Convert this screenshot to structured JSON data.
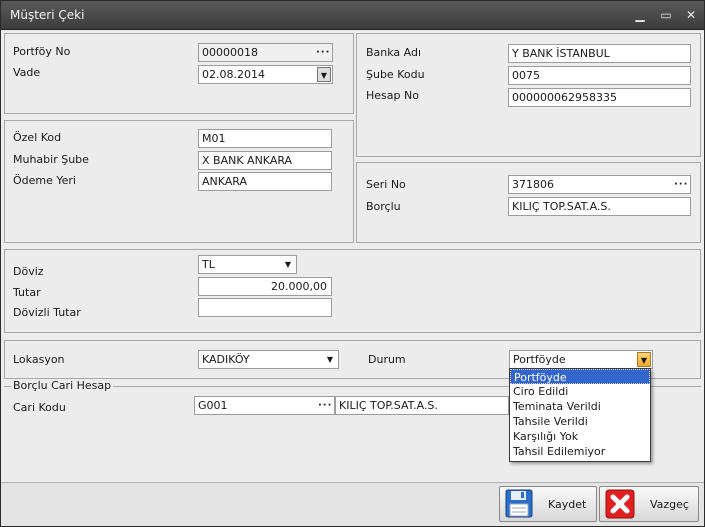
{
  "window": {
    "title": "Müşteri Çeki",
    "minimize": "▁",
    "maximize": "▭",
    "close": "✕"
  },
  "portfoy": {
    "portfoy_no_label": "Portföy No",
    "portfoy_no": "00000018",
    "vade_label": "Vade",
    "vade": "02.08.2014",
    "ellipsis": "···",
    "dropdown_arrow": "▼"
  },
  "banka": {
    "banka_adi_label": "Banka Adı",
    "banka_adi": "Y BANK İSTANBUL",
    "sube_kodu_label": "Şube Kodu",
    "sube_kodu": "0075",
    "hesap_no_label": "Hesap No",
    "hesap_no": "000000062958335"
  },
  "ozel": {
    "ozel_kod_label": "Özel Kod",
    "ozel_kod": "M01",
    "muhabir_sube_label": "Muhabir Şube",
    "muhabir_sube": "X BANK ANKARA",
    "odeme_yeri_label": "Ödeme Yeri",
    "odeme_yeri": "ANKARA"
  },
  "seri": {
    "seri_no_label": "Seri No",
    "seri_no": "371806",
    "borclu_label": "Borçlu",
    "borclu": "KILIÇ TOP.SAT.A.S."
  },
  "doviz": {
    "doviz_label": "Döviz",
    "doviz": "TL",
    "tutar_label": "Tutar",
    "tutar": "20.000,00",
    "dovizli_tutar_label": "Dövizli Tutar",
    "dovizli_tutar": ""
  },
  "lokasyon": {
    "lokasyon_label": "Lokasyon",
    "lokasyon": "KADIKÖY",
    "durum_label": "Durum",
    "durum": "Portföyde"
  },
  "durum_options": [
    "Portföyde",
    "Ciro Edildi",
    "Teminata Verildi",
    "Tahsile Verildi",
    "Karşılığı Yok",
    "Tahsil Edilemiyor"
  ],
  "cari": {
    "group_label": "Borçlu Cari Hesap",
    "cari_kodu_label": "Cari Kodu",
    "cari_kodu": "G001",
    "cari_adi": "KILIÇ TOP.SAT.A.S."
  },
  "buttons": {
    "save": "Kaydet",
    "cancel": "Vazgeç"
  },
  "colors": {
    "titlebar": "#3c3c3c",
    "selection": "#3366cc",
    "cancel_icon": "#e02020",
    "save_icon": "#2a6fc9"
  }
}
